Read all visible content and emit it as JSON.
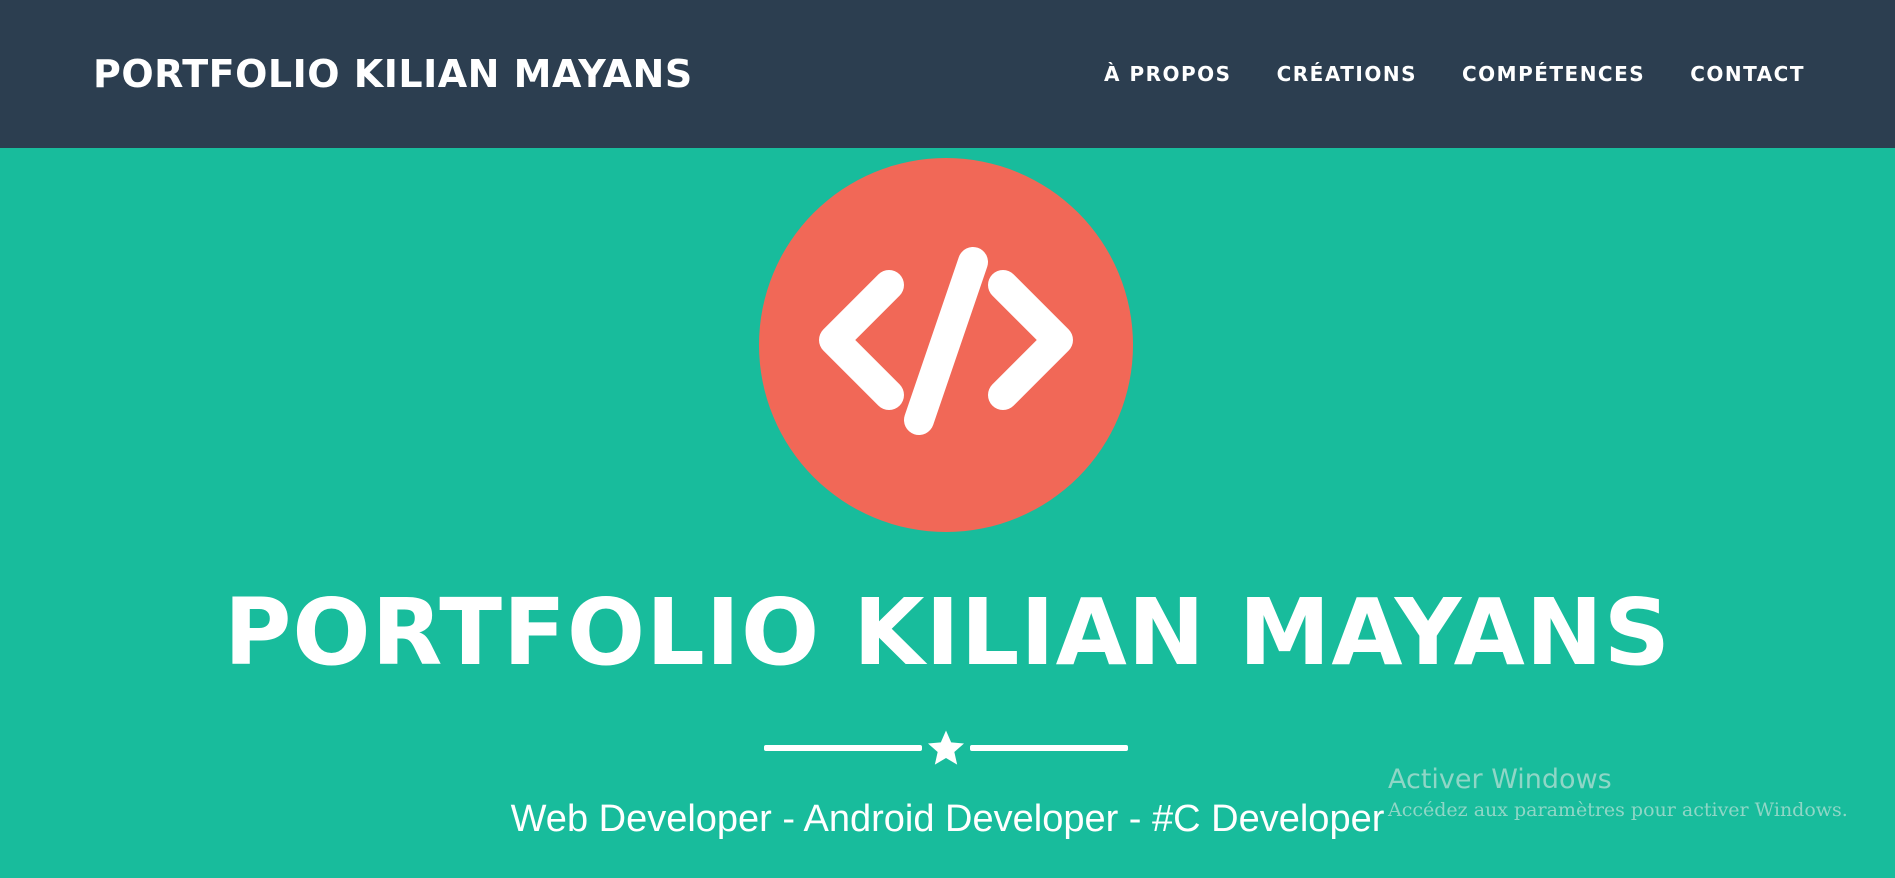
{
  "navbar": {
    "brand": "PORTFOLIO KILIAN MAYANS",
    "links": [
      {
        "label": "À PROPOS"
      },
      {
        "label": "CRÉATIONS"
      },
      {
        "label": "COMPÉTENCES"
      },
      {
        "label": "CONTACT"
      }
    ]
  },
  "hero": {
    "logo_icon": "code-icon",
    "title": "PORTFOLIO KILIAN MAYANS",
    "divider_icon": "star-icon",
    "subtitle": "Web Developer - Android Developer - #C Developer"
  },
  "watermark": {
    "title": "Activer Windows",
    "subtitle": "Accédez aux paramètres pour activer Windows."
  },
  "colors": {
    "navbar_bg": "#2c3e50",
    "hero_bg": "#18bc9c",
    "logo_circle": "#f16857",
    "text": "#ffffff"
  }
}
